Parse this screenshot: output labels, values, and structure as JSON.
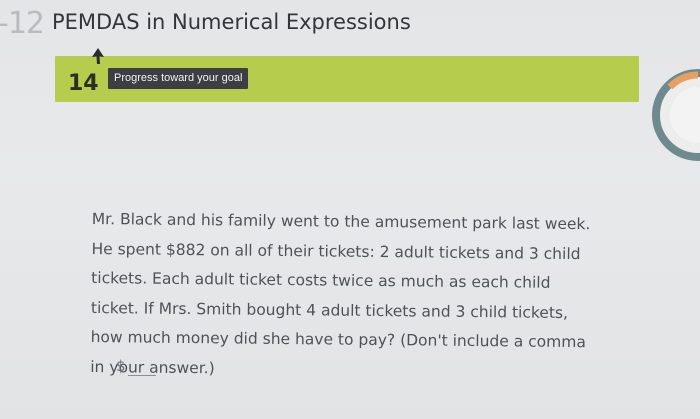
{
  "header": {
    "lesson_number": "-12",
    "title": "PEMDAS in Numerical Expressions"
  },
  "progress": {
    "question_number": "14",
    "label": "Progress toward your goal"
  },
  "question": {
    "lines": [
      "Mr. Black and his family went to the amusement park last week.",
      "He spent $882 on all of their tickets: 2 adult tickets and 3 child",
      "tickets. Each adult ticket costs twice as much as each child",
      "ticket. If Mrs. Smith bought 4 adult tickets and 3 child tickets,",
      "how much money did she have to pay? (Don't include a comma",
      "in your answer.)"
    ]
  },
  "answer": {
    "currency_symbol": "$",
    "value": ""
  },
  "colors": {
    "progress_bar": "#b5cc4c",
    "progress_pill": "#3b3f44",
    "goal_meter_ring": "#6f8a8f",
    "goal_meter_fill": "#e7a060"
  }
}
